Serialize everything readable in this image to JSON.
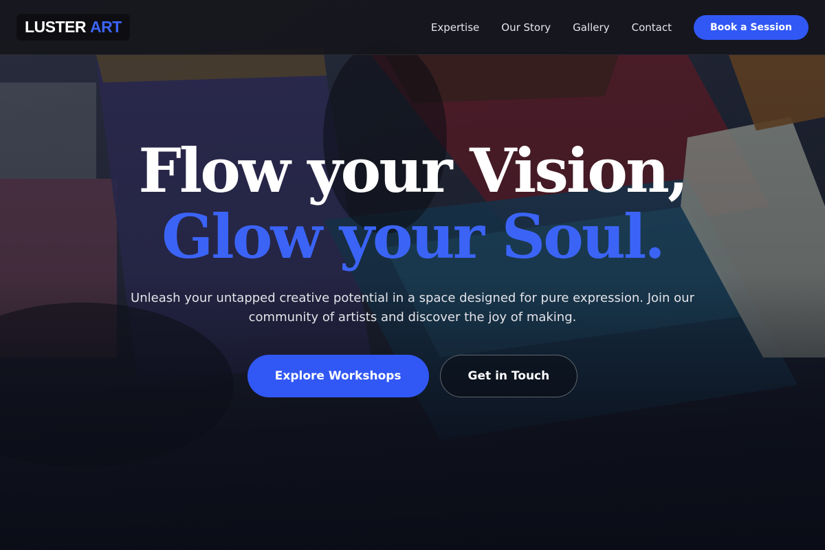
{
  "brand": {
    "part1": "LUSTER",
    "part2": "ART"
  },
  "nav": {
    "items": [
      {
        "label": "Expertise"
      },
      {
        "label": "Our Story"
      },
      {
        "label": "Gallery"
      },
      {
        "label": "Contact"
      }
    ],
    "cta": "Book a Session"
  },
  "hero": {
    "line1": "Flow your Vision,",
    "line2": "Glow your Soul.",
    "subtitle": "Unleash your untapped creative potential in a space designed for pure expression. Join our community of artists and discover the joy of making.",
    "primary_cta": "Explore Workshops",
    "secondary_cta": "Get in Touch"
  },
  "colors": {
    "accent": "#3158f5",
    "accent_text": "#3b64f6",
    "header_bg": "#16161c",
    "page_bg": "#0b0d14"
  },
  "background": {
    "icon": "paintbrushes-image"
  }
}
